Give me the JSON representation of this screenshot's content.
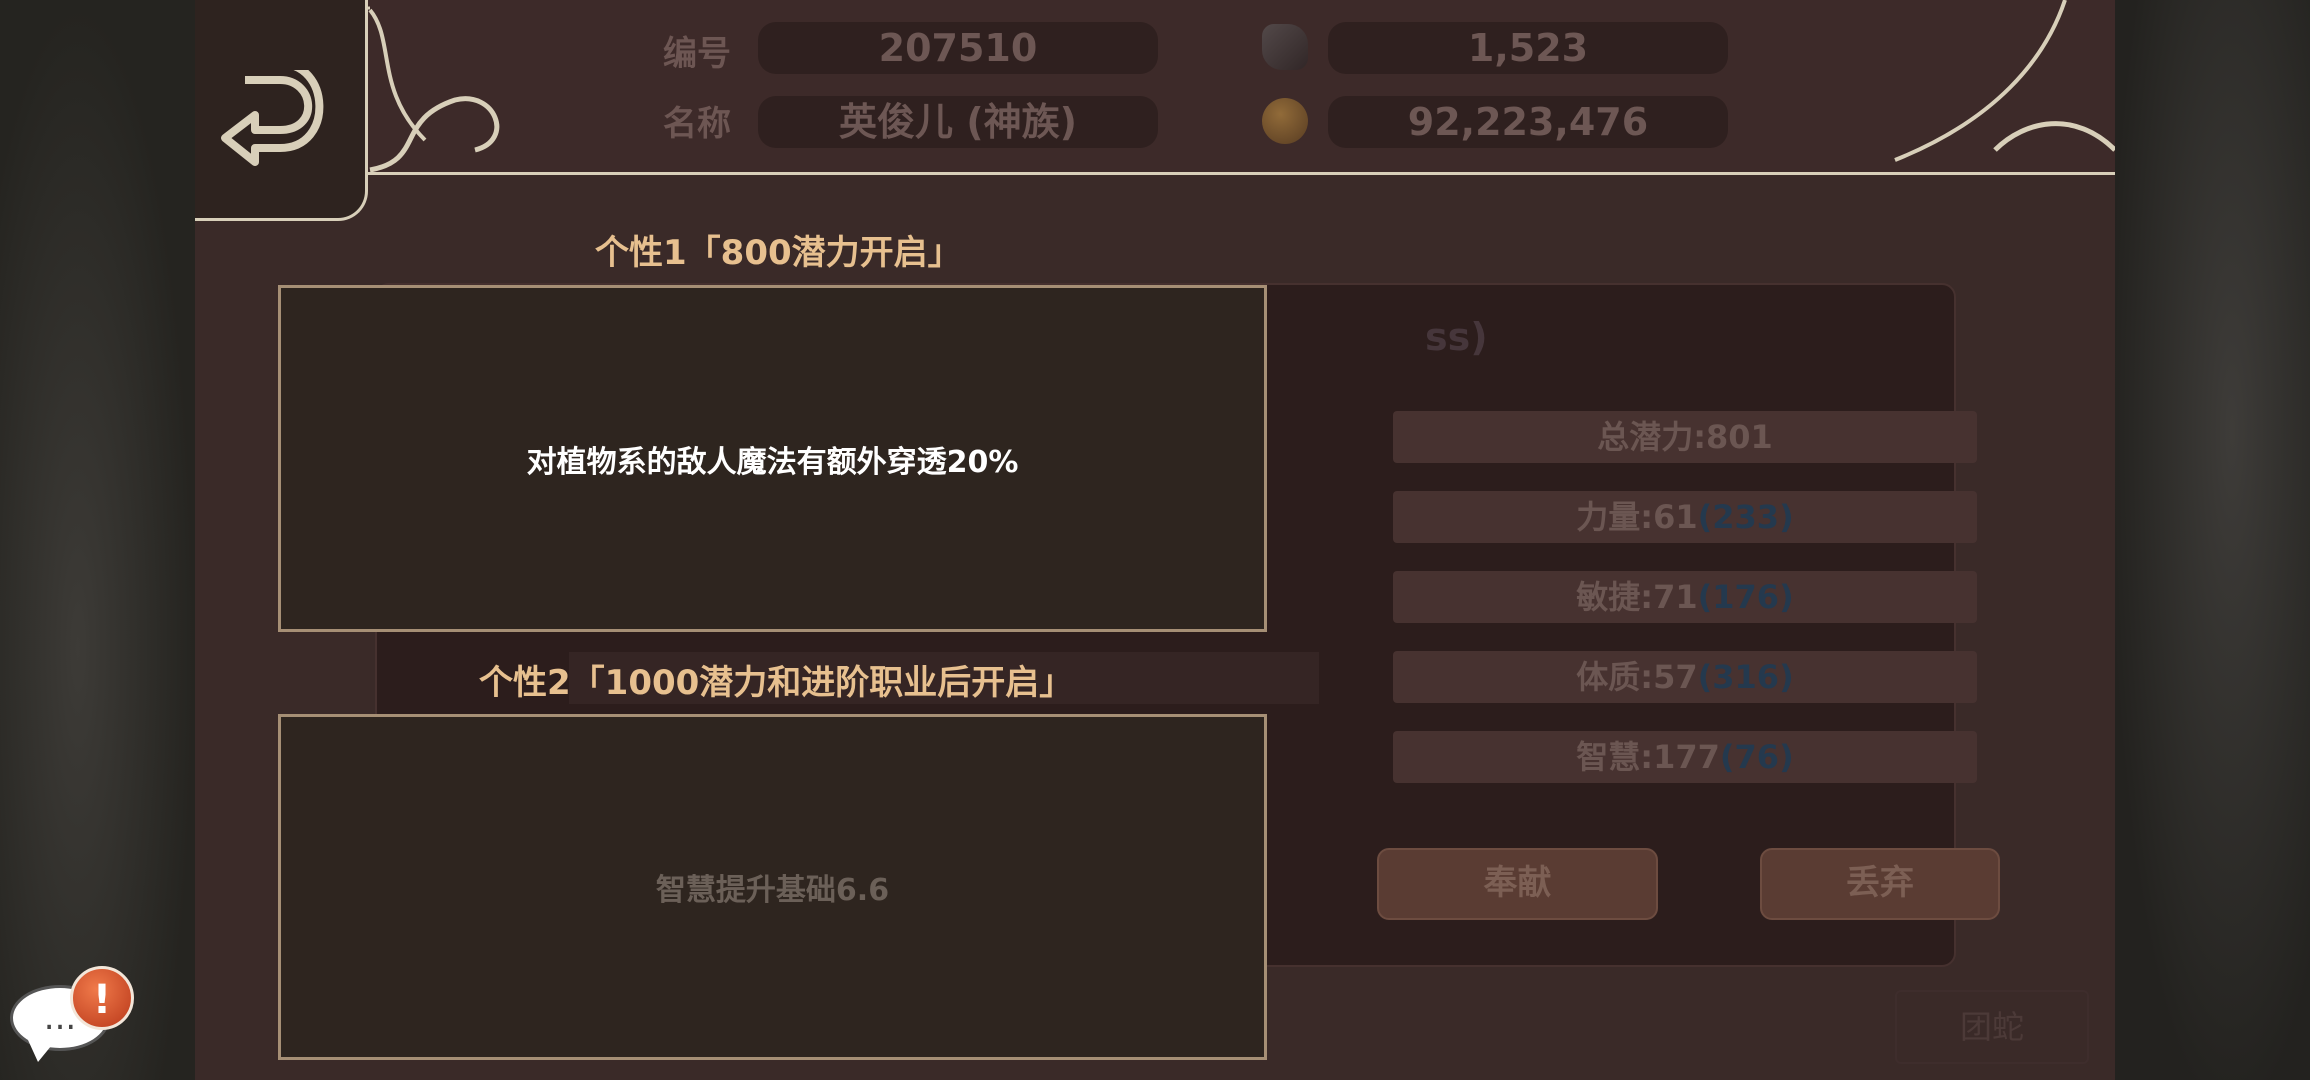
{
  "header": {
    "id_label": "编号",
    "id_value": "207510",
    "name_label": "名称",
    "name_value": "英俊儿 (神族)",
    "gem_icon": "gem-icon",
    "gem_value": "1,523",
    "coin_icon": "coin-icon",
    "coin_value": "92,223,476"
  },
  "back_icon": "back-arrow-icon",
  "background_panel": {
    "partial_title": "ss)",
    "stats": [
      {
        "label": "总潜力:801",
        "extra": ""
      },
      {
        "label": "力量:61",
        "extra": "(233)"
      },
      {
        "label": "敏捷:71",
        "extra": "(176)"
      },
      {
        "label": "体质:57",
        "extra": "(316)"
      },
      {
        "label": "智慧:177",
        "extra": "(76)"
      }
    ],
    "donate_label": "奉献",
    "discard_label": "丢弃",
    "corner_label": "团蛇"
  },
  "trait1": {
    "title": "个性1「800潜力开启」",
    "text": "对植物系的敌人魔法有额外穿透20%",
    "text_color": "#ffffff"
  },
  "trait2": {
    "title": "个性2「1000潜力和进阶职业后开启」",
    "text": "智慧提升基础6.6",
    "text_color": "#6b6058"
  },
  "chat": {
    "bubble_icon": "chat-bubble-icon",
    "bubble_text": "...",
    "alert_icon": "alert-badge-icon",
    "alert_text": "!"
  }
}
